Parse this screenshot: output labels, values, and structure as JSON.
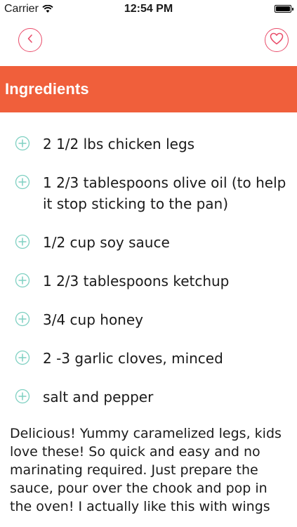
{
  "status_bar": {
    "carrier": "Carrier",
    "time": "12:54 PM"
  },
  "nav": {
    "back_icon": "chevron-left-icon",
    "favorite_icon": "heart-icon"
  },
  "section": {
    "title": "Ingredients"
  },
  "ingredients": [
    "2 1/2 lbs chicken legs",
    "1 2/3 tablespoons olive oil (to help it stop sticking to the pan)",
    "1/2 cup soy sauce",
    "1 2/3 tablespoons ketchup",
    "3/4 cup honey",
    "2 -3 garlic cloves, minced",
    "salt and pepper"
  ],
  "description": "Delicious! Yummy caramelized legs, kids love these! So quick and easy and no marinating required. Just prepare the sauce, pour over the chook and pop in the oven! I actually like this with wings",
  "colors": {
    "accent": "#e94c6a",
    "header_band": "#f05f3b",
    "bullet": "#7fd0c2"
  }
}
